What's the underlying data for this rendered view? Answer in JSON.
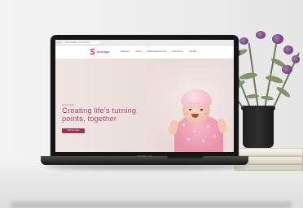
{
  "browser": {
    "url": "www.example.com/your-site"
  },
  "site": {
    "logo_text": "Invisaga",
    "nav_links": [
      "Solutions",
      "About",
      "Patient Experience",
      "Resources",
      "Contact"
    ],
    "eyebrow": "Inspire Hope",
    "headline": "Creating life's turning points, together",
    "cta_label": "Find Out More"
  },
  "laptop": {
    "brand": "MacBook Pro"
  },
  "colors": {
    "brand_primary": "#b5496a",
    "cta_background": "#9b3156",
    "hero_background": "#ebdfdd"
  },
  "icons": {
    "logo": "s-logo-mark"
  }
}
